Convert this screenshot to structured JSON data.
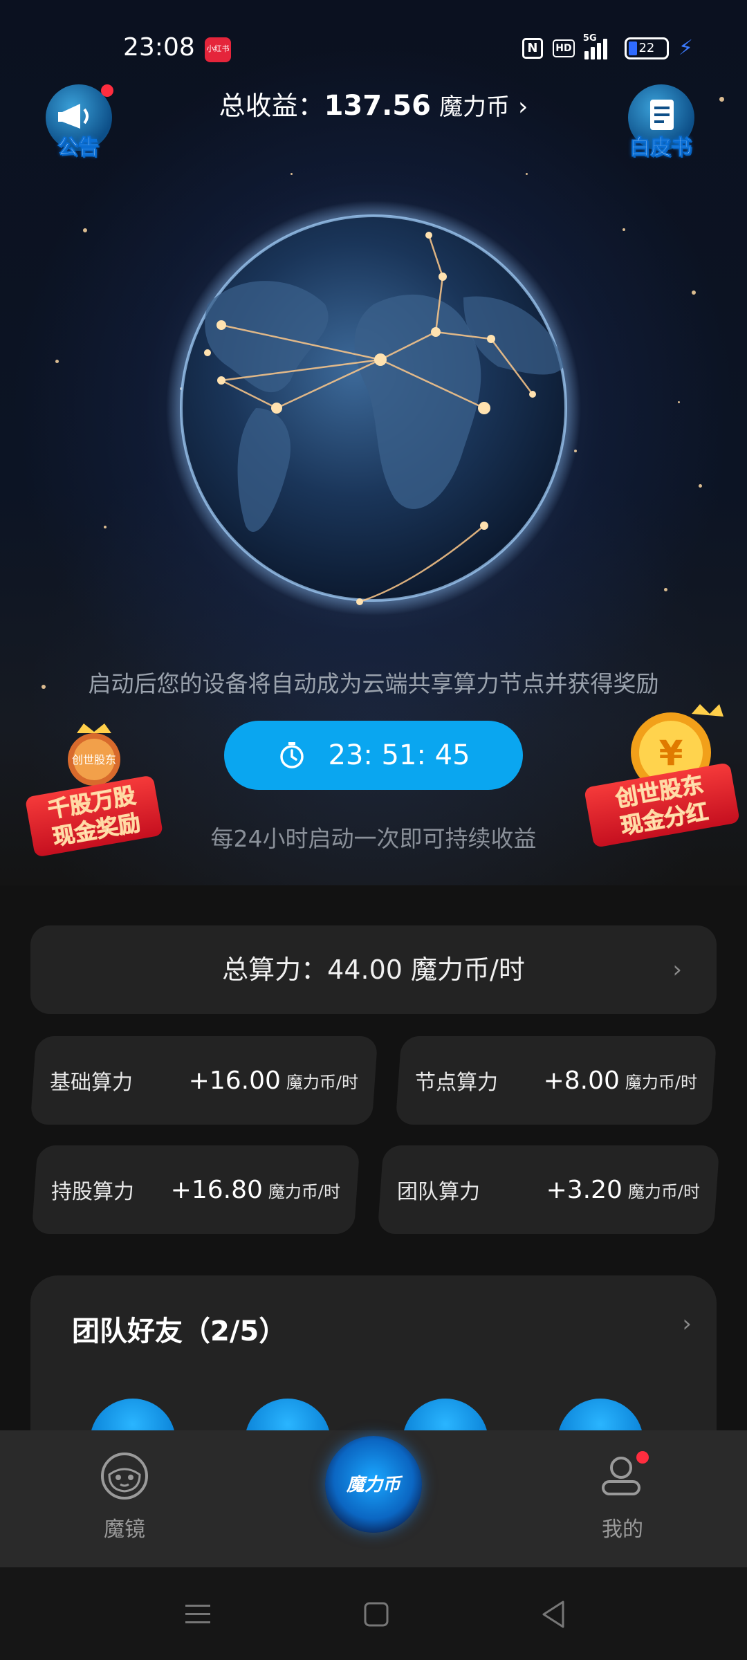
{
  "status_bar": {
    "time": "23:08",
    "app_badge": "小红书",
    "nfc": "N",
    "hd": "HD",
    "network": "5G",
    "battery": "22"
  },
  "header": {
    "notice_label": "公告",
    "whitepaper_label": "白皮书",
    "earnings_label": "总收益：",
    "earnings_value": "137.56",
    "earnings_unit": "魔力币"
  },
  "hero": {
    "description": "启动后您的设备将自动成为云端共享算力节点并获得奖励",
    "timer": "23: 51: 45",
    "hint": "每24小时启动一次即可持续收益",
    "promo_left": "千股万股\n现金奖励",
    "promo_left_badge": "创世股东",
    "promo_right": "创世股东\n现金分红"
  },
  "total_power": {
    "label": "总算力：44.00 魔力币/时"
  },
  "power_cards": [
    {
      "name": "基础算力",
      "value": "+16.00",
      "unit": "魔力币/时"
    },
    {
      "name": "节点算力",
      "value": "+8.00",
      "unit": "魔力币/时"
    },
    {
      "name": "持股算力",
      "value": "+16.80",
      "unit": "魔力币/时"
    },
    {
      "name": "团队算力",
      "value": "+3.20",
      "unit": "魔力币/时"
    }
  ],
  "team": {
    "title": "团队好友（2/5）"
  },
  "nav": {
    "mirror": "魔镜",
    "coin": "魔力币",
    "mine": "我的"
  },
  "colors": {
    "accent": "#0aa6f0",
    "card": "#232323",
    "badge_red": "#ff2d3f"
  }
}
